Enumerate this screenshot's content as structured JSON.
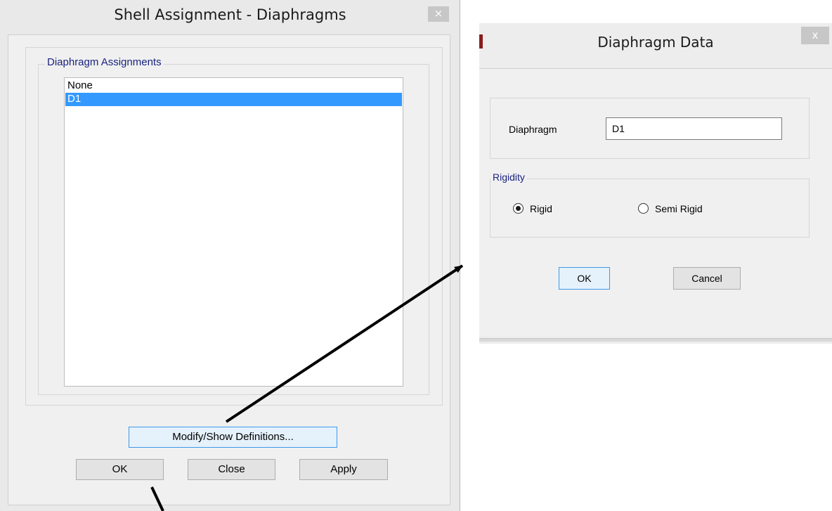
{
  "shell_dialog": {
    "title": "Shell Assignment - Diaphragms",
    "close_glyph": "×",
    "group_label": "Diaphragm Assignments",
    "list_items": [
      {
        "label": "None",
        "selected": false
      },
      {
        "label": "D1",
        "selected": true
      }
    ],
    "modify_button": "Modify/Show Definitions...",
    "ok_button": "OK",
    "close_button": "Close",
    "apply_button": "Apply"
  },
  "diaphragm_dialog": {
    "title": "Diaphragm Data",
    "close_glyph": "x",
    "diaphragm_label": "Diaphragm",
    "diaphragm_value": "D1",
    "rigidity_label": "Rigidity",
    "rigid_label": "Rigid",
    "semi_rigid_label": "Semi Rigid",
    "selected_rigidity": "Rigid",
    "ok_button": "OK",
    "cancel_button": "Cancel"
  },
  "colors": {
    "selection": "#3399ff",
    "group_label": "#1a237e",
    "primary_button_border": "#3c9ae8",
    "arrow": "#000000"
  }
}
